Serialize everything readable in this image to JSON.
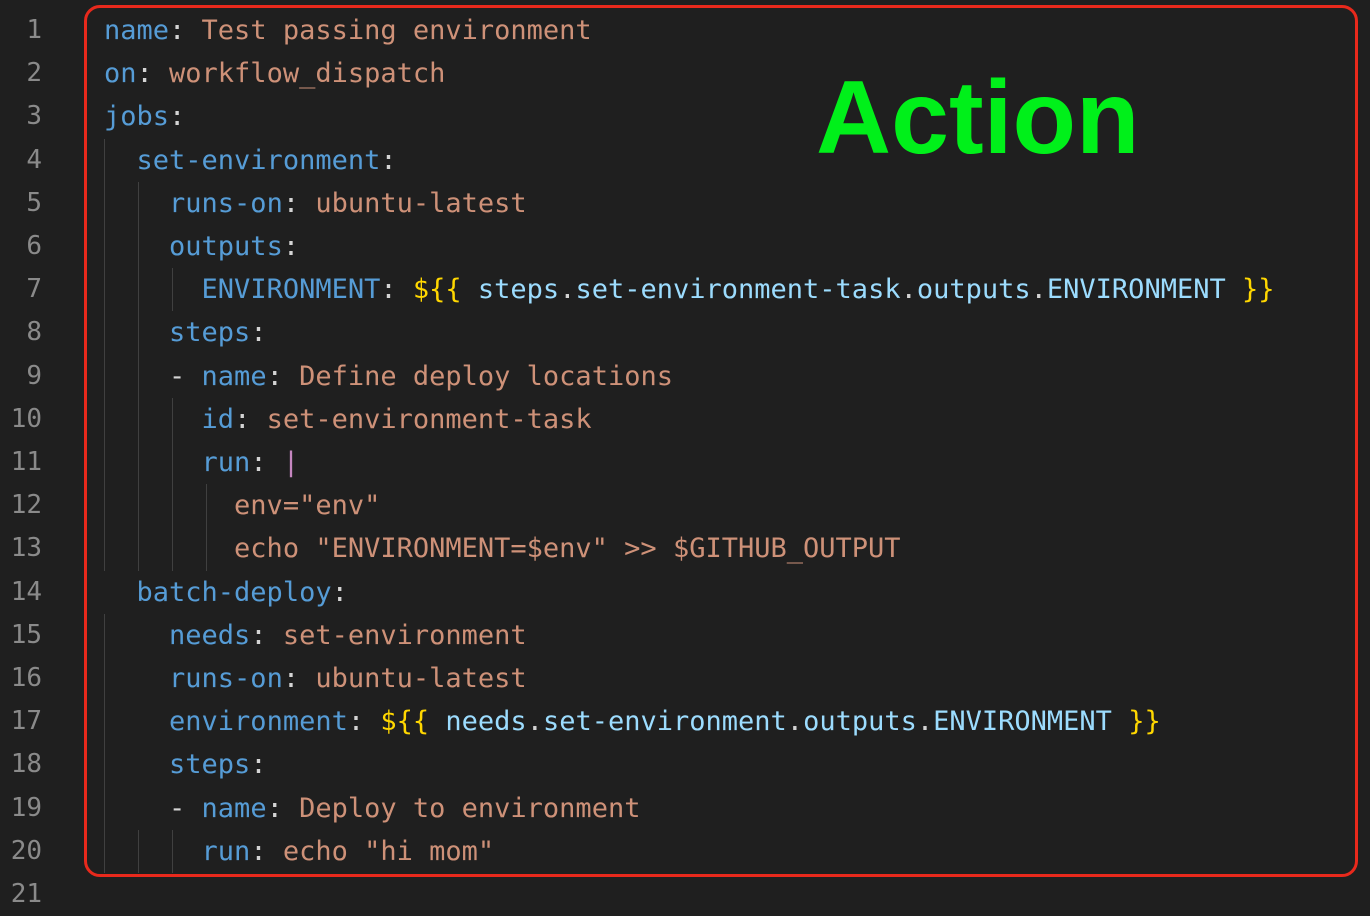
{
  "annotation": {
    "label": "Action",
    "label_color": "#00f01a",
    "frame_color": "#e8291c"
  },
  "editor": {
    "line_numbers": [
      "1",
      "2",
      "3",
      "4",
      "5",
      "6",
      "7",
      "8",
      "9",
      "10",
      "11",
      "12",
      "13",
      "14",
      "15",
      "16",
      "17",
      "18",
      "19",
      "20",
      "21"
    ],
    "lines": [
      {
        "tokens": [
          {
            "t": "name",
            "c": "key"
          },
          {
            "t": ": ",
            "c": "punc"
          },
          {
            "t": "Test passing environment",
            "c": "str"
          }
        ]
      },
      {
        "tokens": [
          {
            "t": "on",
            "c": "key"
          },
          {
            "t": ": ",
            "c": "punc"
          },
          {
            "t": "workflow_dispatch",
            "c": "str"
          }
        ]
      },
      {
        "tokens": [
          {
            "t": "jobs",
            "c": "key"
          },
          {
            "t": ":",
            "c": "punc"
          }
        ]
      },
      {
        "tokens": [
          {
            "t": "  "
          },
          {
            "t": "set-environment",
            "c": "key"
          },
          {
            "t": ":",
            "c": "punc"
          }
        ]
      },
      {
        "tokens": [
          {
            "t": "    "
          },
          {
            "t": "runs-on",
            "c": "key"
          },
          {
            "t": ": ",
            "c": "punc"
          },
          {
            "t": "ubuntu-latest",
            "c": "str"
          }
        ]
      },
      {
        "tokens": [
          {
            "t": "    "
          },
          {
            "t": "outputs",
            "c": "key"
          },
          {
            "t": ":",
            "c": "punc"
          }
        ]
      },
      {
        "tokens": [
          {
            "t": "      "
          },
          {
            "t": "ENVIRONMENT",
            "c": "key"
          },
          {
            "t": ": ",
            "c": "punc"
          },
          {
            "t": "${{",
            "c": "br"
          },
          {
            "t": " steps",
            "c": "var"
          },
          {
            "t": ".",
            "c": "punc"
          },
          {
            "t": "set-environment-task",
            "c": "var"
          },
          {
            "t": ".",
            "c": "punc"
          },
          {
            "t": "outputs",
            "c": "var"
          },
          {
            "t": ".",
            "c": "punc"
          },
          {
            "t": "ENVIRONMENT ",
            "c": "var"
          },
          {
            "t": "}}",
            "c": "br"
          }
        ]
      },
      {
        "tokens": [
          {
            "t": "    "
          },
          {
            "t": "steps",
            "c": "key"
          },
          {
            "t": ":",
            "c": "punc"
          }
        ]
      },
      {
        "tokens": [
          {
            "t": "    "
          },
          {
            "t": "- ",
            "c": "punc"
          },
          {
            "t": "name",
            "c": "key"
          },
          {
            "t": ": ",
            "c": "punc"
          },
          {
            "t": "Define deploy locations",
            "c": "str"
          }
        ]
      },
      {
        "tokens": [
          {
            "t": "      "
          },
          {
            "t": "id",
            "c": "key"
          },
          {
            "t": ": ",
            "c": "punc"
          },
          {
            "t": "set-environment-task",
            "c": "str"
          }
        ]
      },
      {
        "tokens": [
          {
            "t": "      "
          },
          {
            "t": "run",
            "c": "key"
          },
          {
            "t": ": ",
            "c": "punc"
          },
          {
            "t": "|",
            "c": "pipe"
          }
        ]
      },
      {
        "tokens": [
          {
            "t": "        "
          },
          {
            "t": "env=\"env\"",
            "c": "str"
          }
        ]
      },
      {
        "tokens": [
          {
            "t": "        "
          },
          {
            "t": "echo \"ENVIRONMENT=$env\" >> $GITHUB_OUTPUT",
            "c": "str"
          }
        ]
      },
      {
        "tokens": [
          {
            "t": "  "
          },
          {
            "t": "batch-deploy",
            "c": "key"
          },
          {
            "t": ":",
            "c": "punc"
          }
        ]
      },
      {
        "tokens": [
          {
            "t": "    "
          },
          {
            "t": "needs",
            "c": "key"
          },
          {
            "t": ": ",
            "c": "punc"
          },
          {
            "t": "set-environment",
            "c": "str"
          }
        ]
      },
      {
        "tokens": [
          {
            "t": "    "
          },
          {
            "t": "runs-on",
            "c": "key"
          },
          {
            "t": ": ",
            "c": "punc"
          },
          {
            "t": "ubuntu-latest",
            "c": "str"
          }
        ]
      },
      {
        "tokens": [
          {
            "t": "    "
          },
          {
            "t": "environment",
            "c": "key"
          },
          {
            "t": ": ",
            "c": "punc"
          },
          {
            "t": "${{",
            "c": "br"
          },
          {
            "t": " needs",
            "c": "var"
          },
          {
            "t": ".",
            "c": "punc"
          },
          {
            "t": "set-environment",
            "c": "var"
          },
          {
            "t": ".",
            "c": "punc"
          },
          {
            "t": "outputs",
            "c": "var"
          },
          {
            "t": ".",
            "c": "punc"
          },
          {
            "t": "ENVIRONMENT ",
            "c": "var"
          },
          {
            "t": "}}",
            "c": "br"
          }
        ]
      },
      {
        "tokens": [
          {
            "t": "    "
          },
          {
            "t": "steps",
            "c": "key"
          },
          {
            "t": ":",
            "c": "punc"
          }
        ]
      },
      {
        "tokens": [
          {
            "t": "    "
          },
          {
            "t": "- ",
            "c": "punc"
          },
          {
            "t": "name",
            "c": "key"
          },
          {
            "t": ": ",
            "c": "punc"
          },
          {
            "t": "Deploy to environment",
            "c": "str"
          }
        ]
      },
      {
        "tokens": [
          {
            "t": "      "
          },
          {
            "t": "run",
            "c": "key"
          },
          {
            "t": ": ",
            "c": "punc"
          },
          {
            "t": "echo \"hi mom\"",
            "c": "str"
          }
        ]
      },
      {
        "tokens": []
      }
    ]
  }
}
